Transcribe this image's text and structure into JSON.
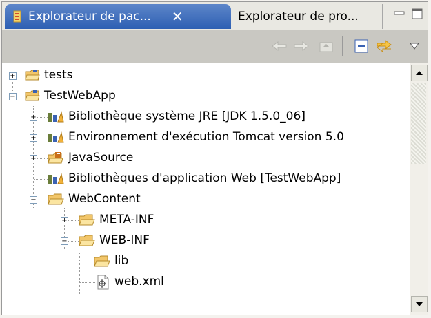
{
  "tabs": [
    {
      "label": "Explorateur de pac...",
      "active": true,
      "close": "✕"
    },
    {
      "label": "Explorateur de pro...",
      "active": false
    }
  ],
  "toolbar": {
    "icons": [
      "back-arrow-icon",
      "forward-arrow-icon",
      "up-folder-icon",
      "collapse-all-icon",
      "link-editor-icon",
      "view-menu-icon"
    ]
  },
  "tree": {
    "items": [
      {
        "label": "tests",
        "icon": "project-folder-icon",
        "expander": "+"
      },
      {
        "label": "TestWebApp",
        "icon": "project-folder-icon",
        "expander": "−"
      },
      {
        "label": "Bibliothèque système JRE [JDK 1.5.0_06]",
        "icon": "library-icon",
        "expander": "+"
      },
      {
        "label": "Environnement d'exécution Tomcat version 5.0",
        "icon": "library-icon",
        "expander": "+"
      },
      {
        "label": "JavaSource",
        "icon": "source-folder-icon",
        "expander": "+"
      },
      {
        "label": "Bibliothèques d'application Web [TestWebApp]",
        "icon": "library-icon",
        "expander": ""
      },
      {
        "label": "WebContent",
        "icon": "open-folder-icon",
        "expander": "−"
      },
      {
        "label": "META-INF",
        "icon": "open-folder-icon",
        "expander": "+"
      },
      {
        "label": "WEB-INF",
        "icon": "open-folder-icon",
        "expander": "−"
      },
      {
        "label": "lib",
        "icon": "open-folder-icon",
        "expander": ""
      },
      {
        "label": "web.xml",
        "icon": "xml-file-icon",
        "expander": ""
      }
    ]
  },
  "colors": {
    "active_tab": "#2d5fb3",
    "toolbar": "#c9c8c2",
    "folder": "#f2c66a"
  }
}
